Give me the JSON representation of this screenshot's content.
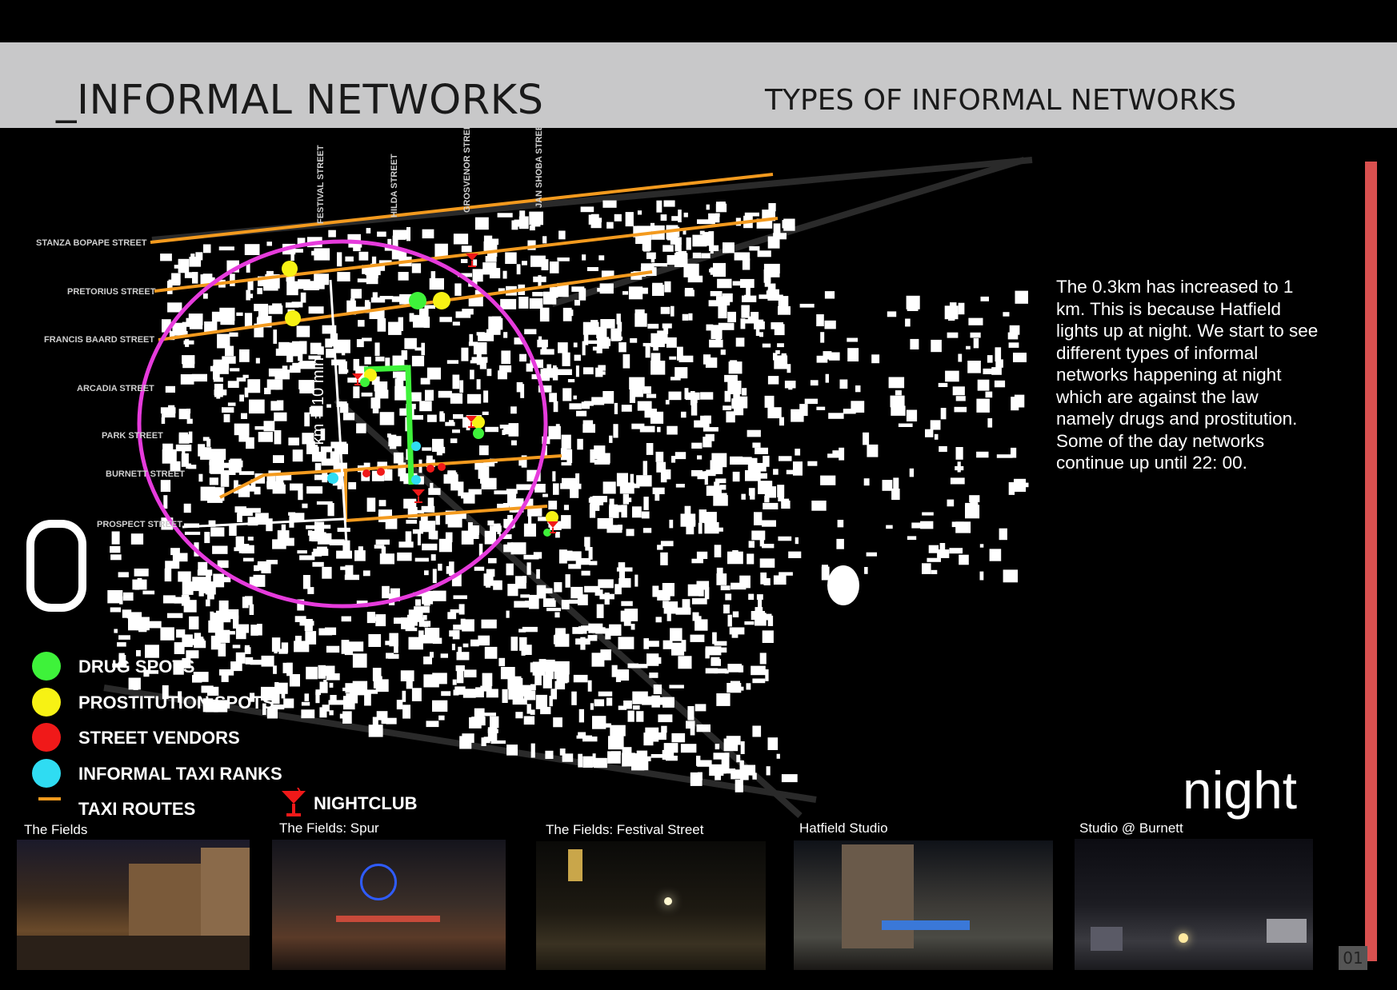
{
  "header": {
    "title": "_INFORMAL NETWORKS",
    "subtitle": "TYPES OF INFORMAL NETWORKS"
  },
  "description": "The 0.3km has increased to 1 km. This is because Hatfield lights up at night. We start to see different types of informal networks happening at night which are against the law namely drugs and prostitution. Some of the day networks continue up until 22: 00.",
  "time_label": "night",
  "page_number": "01",
  "map": {
    "scale_label": "1 km = 10 min",
    "horizontal_streets": [
      "STANZA BOPAPE STREET",
      "PRETORIUS STREET",
      "FRANCIS BAARD STREET",
      "ARCADIA STREET",
      "PARK STREET",
      "BURNETT STREET",
      "PROSPECT STREET"
    ],
    "vertical_streets": [
      "FESTIVAL STREET",
      "HILDA STREET",
      "GROSVENOR STREET",
      "JAN SHOBA STREET"
    ],
    "colors": {
      "drug": "#3ef23a",
      "prostitution": "#f7f214",
      "vendor": "#f01919",
      "taxi_rank": "#2fdcf2",
      "taxi_route": "#f39a1e",
      "radius": "#e63bdc"
    }
  },
  "legend": [
    {
      "label": "DRUG SPOTS",
      "color": "#3ef23a",
      "shape": "dot"
    },
    {
      "label": "PROSTITUTION SPOTS",
      "color": "#f7f214",
      "shape": "dot"
    },
    {
      "label": "STREET VENDORS",
      "color": "#f01919",
      "shape": "dot"
    },
    {
      "label": "INFORMAL TAXI RANKS",
      "color": "#2fdcf2",
      "shape": "dot"
    },
    {
      "label": "TAXI ROUTES",
      "color": "#f39a1e",
      "shape": "line"
    }
  ],
  "nightclub": {
    "label": "NIGHTCLUB",
    "icon": "cocktail-glass-icon"
  },
  "photos": [
    {
      "caption": "The Fields"
    },
    {
      "caption": "The Fields: Spur"
    },
    {
      "caption": "The Fields: Festival Street"
    },
    {
      "caption": "Hatfield Studio"
    },
    {
      "caption": "Studio @ Burnett"
    }
  ]
}
